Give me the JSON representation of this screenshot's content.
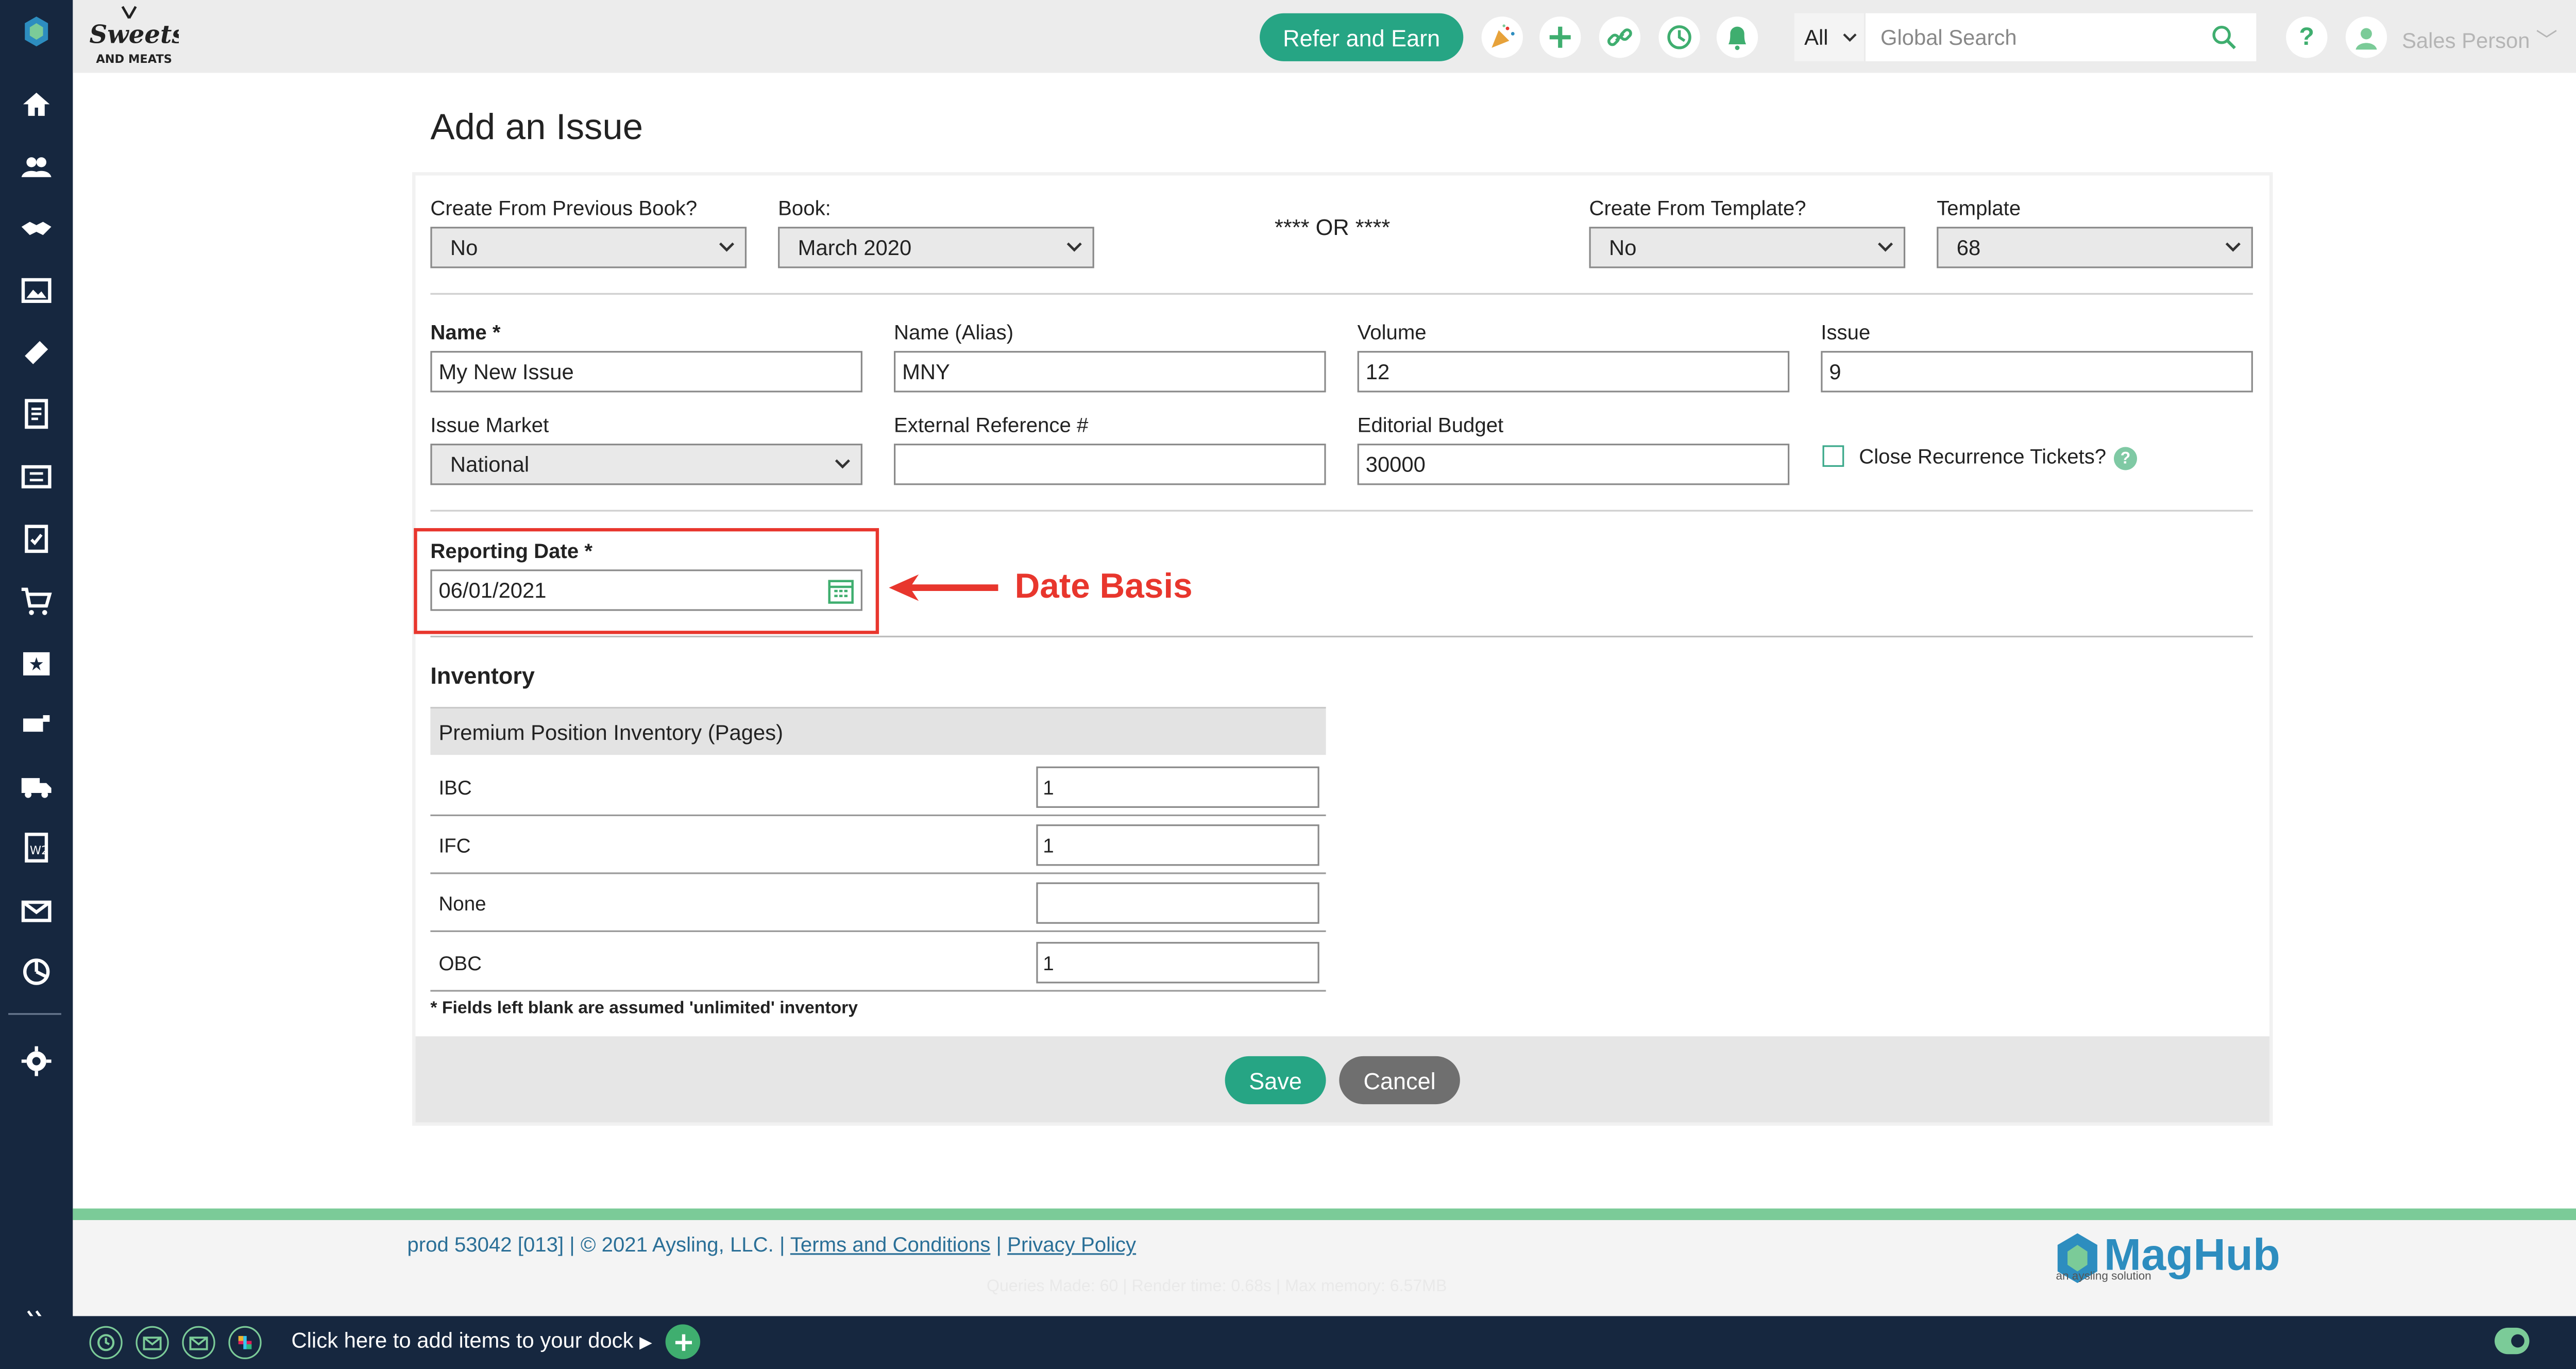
{
  "header": {
    "refer_label": "Refer and Earn",
    "search_scope": "All",
    "search_placeholder": "Global Search",
    "user_name": "Sales Person"
  },
  "page": {
    "title": "Add an Issue"
  },
  "form": {
    "create_prev_label": "Create From Previous Book?",
    "create_prev_value": "No",
    "book_label": "Book:",
    "book_value": "March 2020",
    "or_text": "**** OR ****",
    "create_template_label": "Create From Template?",
    "create_template_value": "No",
    "template_label": "Template",
    "template_value": "68",
    "name_label": "Name *",
    "name_value": "My New Issue",
    "alias_label": "Name (Alias)",
    "alias_value": "MNY",
    "volume_label": "Volume",
    "volume_value": "12",
    "issue_label": "Issue",
    "issue_value": "9",
    "market_label": "Issue Market",
    "market_value": "National",
    "extref_label": "External Reference #",
    "extref_value": "",
    "budget_label": "Editorial Budget",
    "budget_value": "30000",
    "close_recurrence_label": "Close Recurrence Tickets?",
    "reporting_label": "Reporting Date *",
    "reporting_value": "06/01/2021"
  },
  "annotation": {
    "text": "Date Basis",
    "color": "#e8362d"
  },
  "inventory": {
    "title": "Inventory",
    "header": "Premium Position Inventory (Pages)",
    "rows": [
      {
        "name": "IBC",
        "value": "1"
      },
      {
        "name": "IFC",
        "value": "1"
      },
      {
        "name": "None",
        "value": ""
      },
      {
        "name": "OBC",
        "value": "1"
      }
    ],
    "footnote": "* Fields left blank are assumed 'unlimited' inventory"
  },
  "actions": {
    "save": "Save",
    "cancel": "Cancel"
  },
  "footer": {
    "build": "prod 53042 [013] | © 2021 Aysling, LLC. |",
    "terms": "Terms and Conditions",
    "sep": "|",
    "privacy": "Privacy Policy",
    "stats": "Queries Made: 60 | Render time: 0.68s | Max memory: 6.57MB",
    "brand": "MagHub",
    "brand_sub": "an aysling solution"
  },
  "dock": {
    "text": "Click here to add items to your dock"
  },
  "colors": {
    "accent": "#26a584",
    "sidebar": "#16273f",
    "brand_blue": "#2d8dbf"
  }
}
